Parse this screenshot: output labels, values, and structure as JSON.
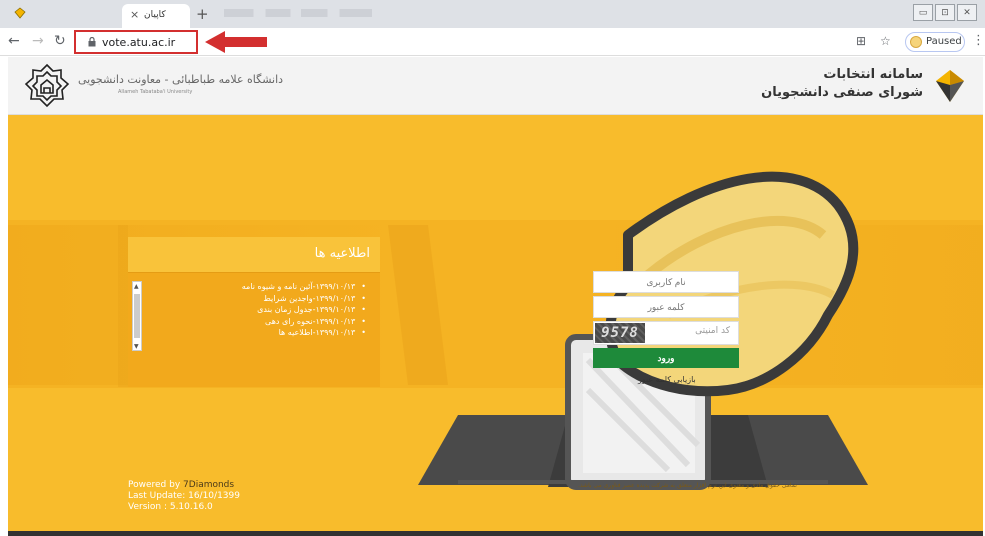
{
  "browser": {
    "tab_title": "کاپیان",
    "tab_close": "×",
    "new_tab": "+",
    "url": "vote.atu.ac.ir",
    "profile_status": "Paused",
    "window_buttons": [
      "▭",
      "⊡",
      "✕"
    ]
  },
  "header": {
    "university_name": "دانشگاه علامه طباطبائی - معاونت دانشجویی",
    "university_name_en": "Allameh Tabataba'i University",
    "system_title_line1": "سامانه انتخابات",
    "system_title_line2": "شورای صنفی دانشجویان"
  },
  "news": {
    "title": "اطلاعیه ها",
    "items": [
      "۱۳۹۹/۱۰/۱۳-آئین نامه و شیوه نامه",
      "۱۳۹۹/۱۰/۱۳-واجدین شرایط",
      "۱۳۹۹/۱۰/۱۳-جدول زمان بندی",
      "۱۳۹۹/۱۰/۱۳-نحوه رای دهی",
      "۱۳۹۹/۱۰/۱۳-اطلاعیه ها"
    ]
  },
  "login": {
    "username_placeholder": "نام کاربری",
    "password_placeholder": "کلمه عبور",
    "captcha_placeholder": "کد امنیتی",
    "captcha_code": "9578",
    "submit_label": "ورود",
    "forgot_label": "بازیابی کلمه عبور"
  },
  "footer": {
    "powered_prefix": "Powered by ",
    "powered_by": "7Diamonds",
    "last_update": "Last Update: 16/10/1399",
    "version": "Version : 5.10.16.0",
    "copyright": "تمامی حقوق مادی و معنوی این نرم افزار متعلق به شرکت پدیده عصر فناوری می باشد."
  },
  "colors": {
    "banner": "#f8bc2c",
    "news_panel": "#f2a91c",
    "login_button": "#1e8a3a",
    "highlight_box": "#d32f2f"
  }
}
